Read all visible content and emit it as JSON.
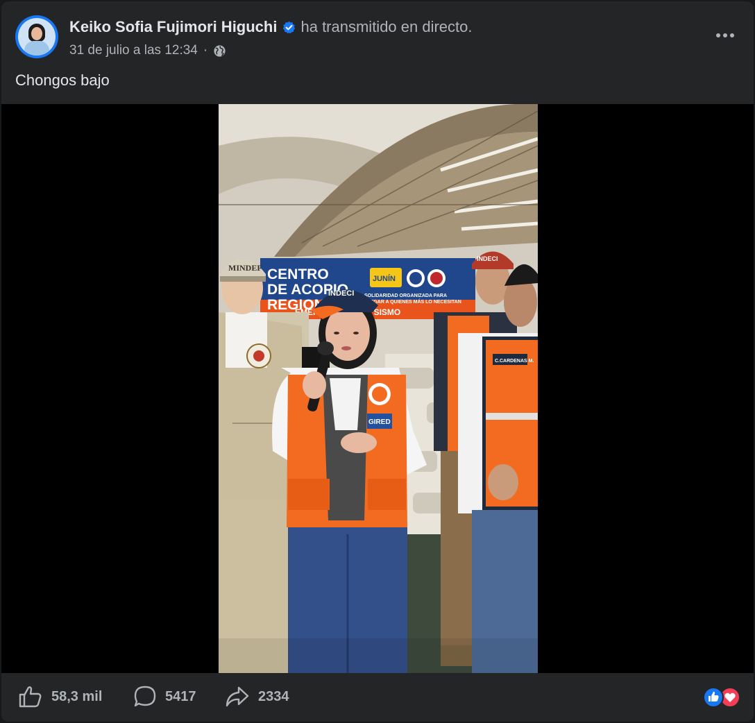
{
  "post": {
    "author": "Keiko Sofia Fujimori Higuchi",
    "action": "ha transmitido en directo.",
    "timestamp": "31 de julio a las 12:34",
    "separator": "·",
    "privacy_icon": "globe-icon",
    "caption": "Chongos bajo"
  },
  "video": {
    "banner_line1": "CENTRO",
    "banner_line2": "DE ACOPIO",
    "banner_line3": "REGIONAL",
    "banner_region": "JUNÍN",
    "banner_tagline1": "SOLIDARIDAD ORGANIZADA PARA",
    "banner_tagline2": "LLEGAR A QUIENES MÁS LO NECESITAN",
    "banner_bottom": "EMERGENCIA POR SISMO",
    "cap_left": "MINDEF",
    "cap_center": "INDECI",
    "cap_right": "INDECI",
    "patch_text": "GIRED",
    "name_tag": "C.CARDENAS M."
  },
  "stats": {
    "likes": "58,3 mil",
    "comments": "5417",
    "shares": "2334"
  },
  "colors": {
    "verified": "#1877f2",
    "like": "#1877f2",
    "love": "#f33e58",
    "vest": "#f26b21"
  }
}
